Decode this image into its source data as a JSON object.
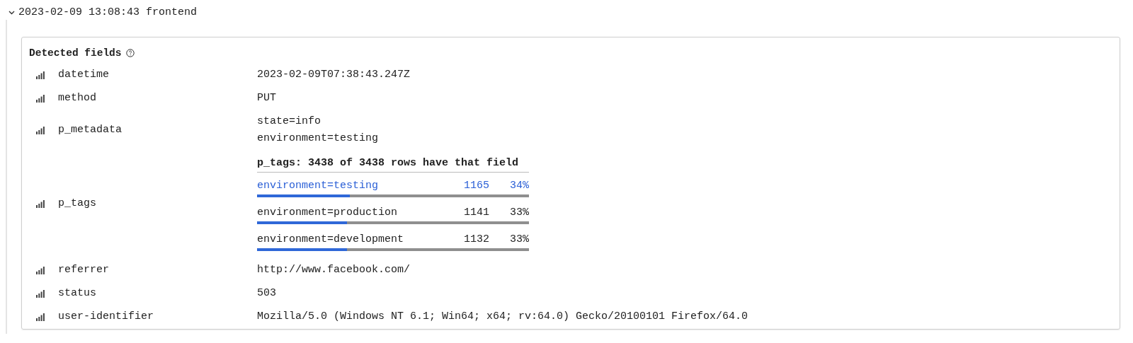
{
  "entry": {
    "expanded": true,
    "title": "2023-02-09 13:08:43 frontend"
  },
  "detected_fields": {
    "title": "Detected fields",
    "fields": [
      {
        "kind": "text",
        "name": "datetime",
        "values": [
          "2023-02-09T07:38:43.247Z"
        ]
      },
      {
        "kind": "text",
        "name": "method",
        "values": [
          "PUT"
        ]
      },
      {
        "kind": "text",
        "name": "p_metadata",
        "values": [
          "state=info",
          "environment=testing"
        ]
      },
      {
        "kind": "stats",
        "name": "p_tags",
        "stats": {
          "title": "p_tags: 3438 of 3438 rows have that field",
          "items": [
            {
              "value": "environment=testing",
              "count": "1165",
              "percent": "34%",
              "level": 0.34,
              "selected": true
            },
            {
              "value": "environment=production",
              "count": "1141",
              "percent": "33%",
              "level": 0.33,
              "selected": false
            },
            {
              "value": "environment=development",
              "count": "1132",
              "percent": "33%",
              "level": 0.33,
              "selected": false
            }
          ]
        }
      },
      {
        "kind": "text",
        "name": "referrer",
        "values": [
          "http://www.facebook.com/"
        ]
      },
      {
        "kind": "text",
        "name": "status",
        "values": [
          "503"
        ]
      },
      {
        "kind": "text",
        "name": "user-identifier",
        "values": [
          "Mozilla/5.0 (Windows NT 6.1; Win64; x64; rv:64.0) Gecko/20100101 Firefox/64.0"
        ]
      }
    ]
  }
}
